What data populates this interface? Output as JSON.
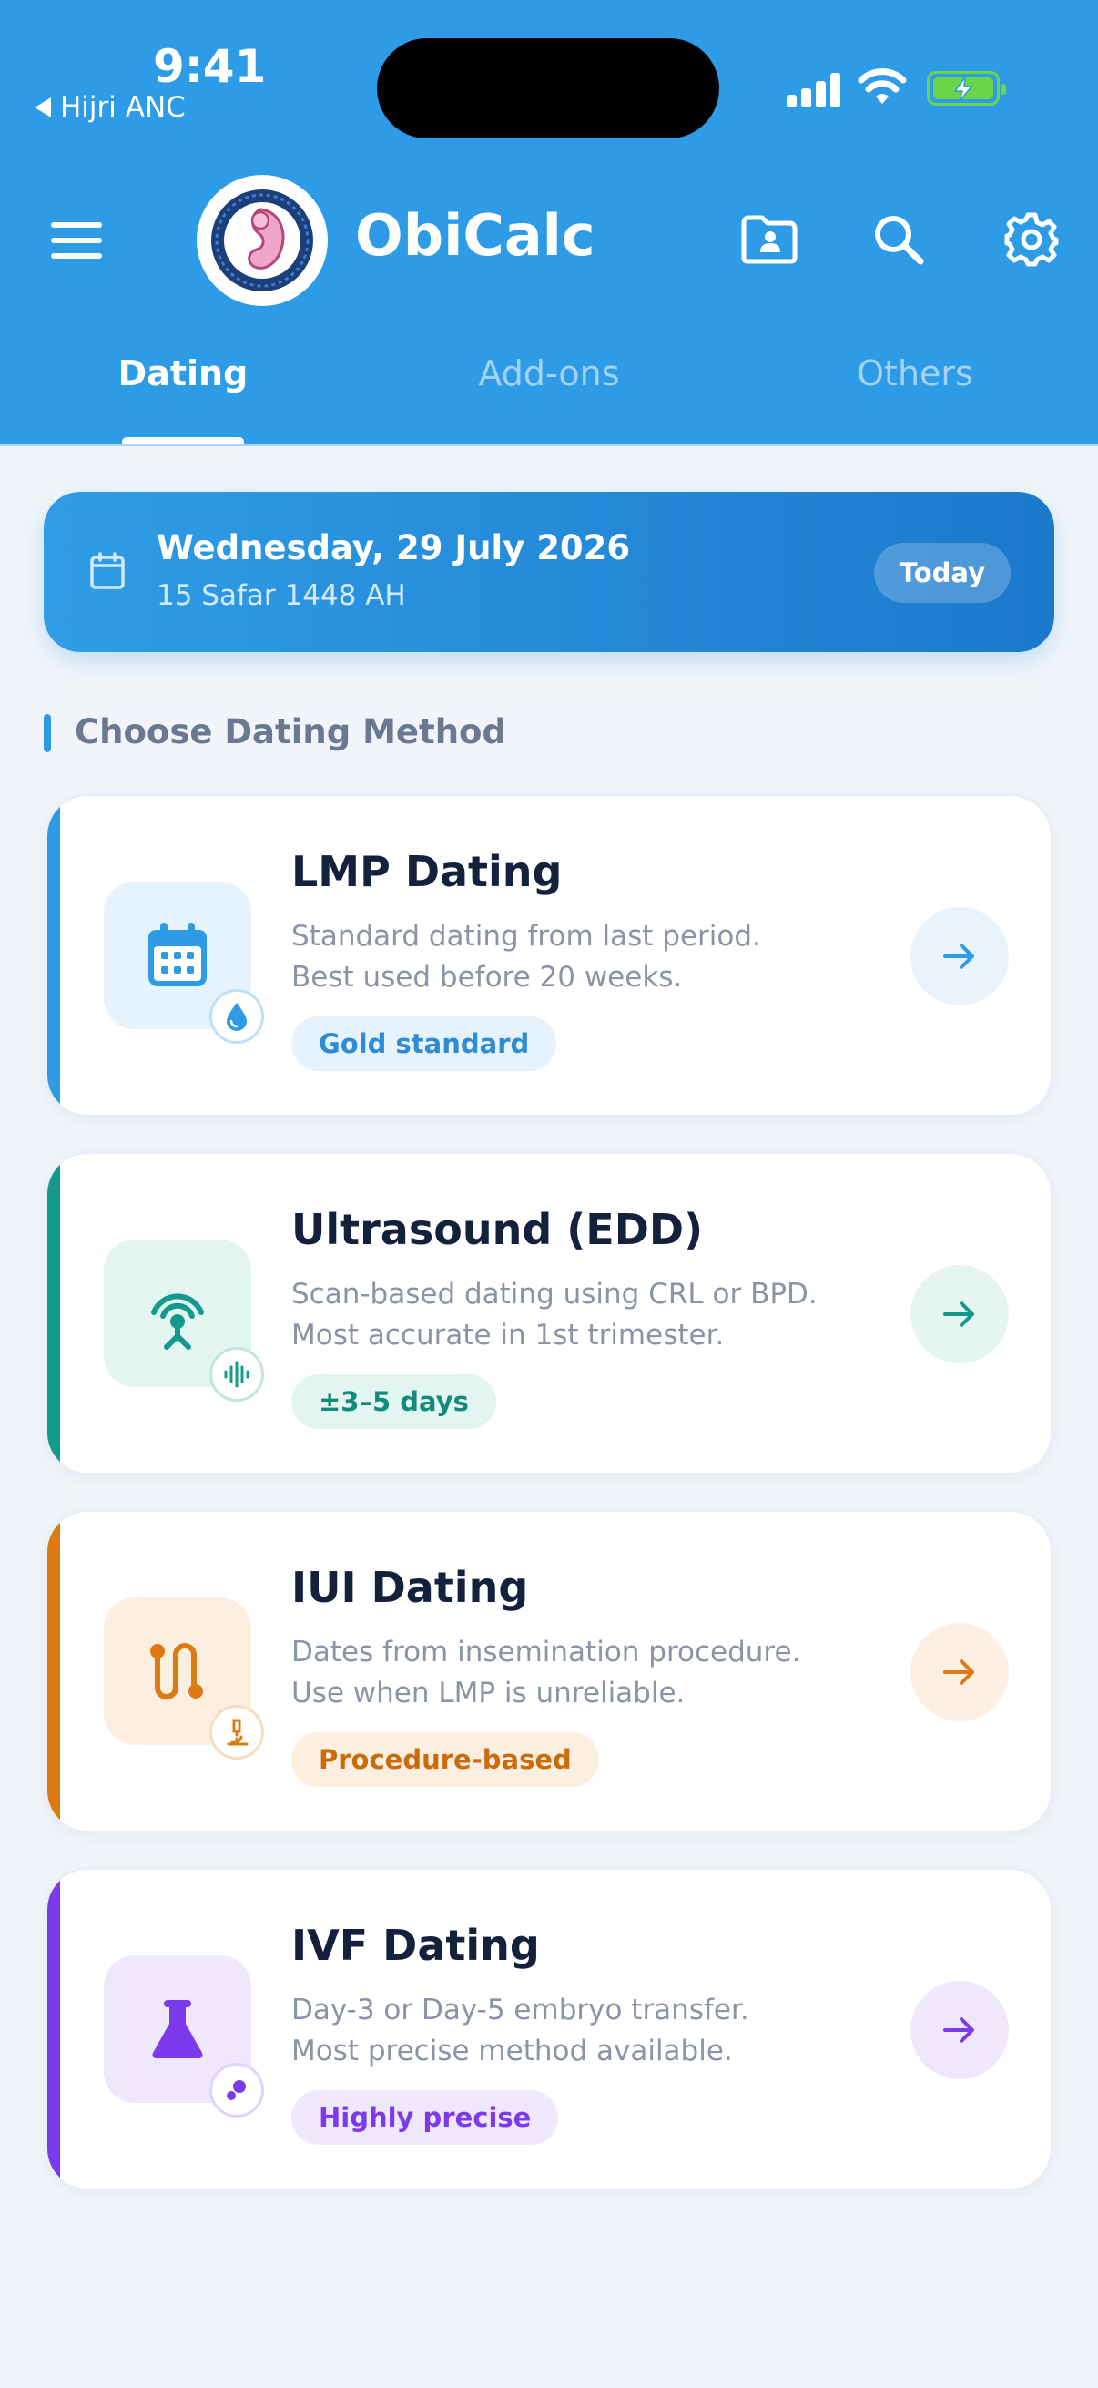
{
  "status_bar": {
    "time": "9:41",
    "back_label": "Hijri ANC"
  },
  "header": {
    "title": "ObiCalc",
    "icons": [
      "menu-icon",
      "patient-folder-icon",
      "search-icon",
      "settings-icon"
    ]
  },
  "tabs": [
    {
      "label": "Dating",
      "active": true
    },
    {
      "label": "Add-ons",
      "active": false
    },
    {
      "label": "Others",
      "active": false
    }
  ],
  "date_banner": {
    "gregorian": "Wednesday, 29 July 2026",
    "hijri": "15 Safar 1448 AH",
    "today_label": "Today"
  },
  "section_title": "Choose Dating Method",
  "methods": [
    {
      "title": "LMP Dating",
      "desc_line1": "Standard dating from last period.",
      "desc_line2": "Best used before 20 weeks.",
      "tag": "Gold standard",
      "accent": "#2e9be6",
      "icon": "calendar-icon",
      "badge_icon": "droplet-icon"
    },
    {
      "title": "Ultrasound (EDD)",
      "desc_line1": "Scan-based dating using CRL or BPD.",
      "desc_line2": "Most accurate in 1st trimester.",
      "tag": "±3–5 days",
      "accent": "#14998a",
      "icon": "ultrasound-probe-icon",
      "badge_icon": "soundwave-icon"
    },
    {
      "title": "IUI Dating",
      "desc_line1": "Dates from insemination procedure.",
      "desc_line2": "Use when LMP is unreliable.",
      "tag": "Procedure-based",
      "accent": "#dc7a14",
      "icon": "route-icon",
      "badge_icon": "microscope-icon"
    },
    {
      "title": "IVF Dating",
      "desc_line1": "Day-3 or Day-5 embryo transfer.",
      "desc_line2": "Most precise method available.",
      "tag": "Highly precise",
      "accent": "#7c3aed",
      "icon": "flask-icon",
      "badge_icon": "embryo-cells-icon"
    }
  ]
}
